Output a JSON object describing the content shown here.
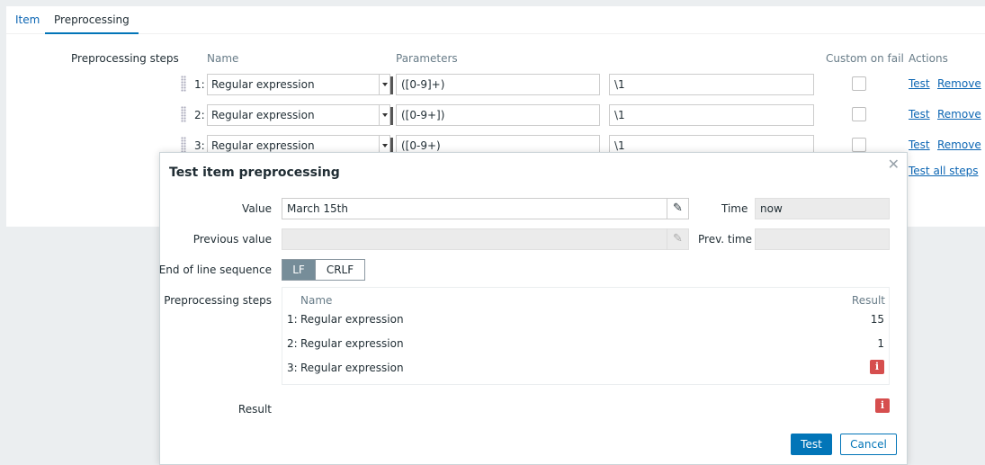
{
  "tabs": [
    {
      "label": "Item"
    },
    {
      "label": "Preprocessing"
    }
  ],
  "form": {
    "section_label": "Preprocessing steps",
    "headers": {
      "name": "Name",
      "parameters": "Parameters",
      "custom_on_fail": "Custom on fail",
      "actions": "Actions"
    },
    "steps": [
      {
        "num": "1:",
        "name": "Regular expression",
        "param1": "([0-9]+)",
        "param2": "\\1",
        "test": "Test",
        "remove": "Remove"
      },
      {
        "num": "2:",
        "name": "Regular expression",
        "param1": "([0-9+])",
        "param2": "\\1",
        "test": "Test",
        "remove": "Remove"
      },
      {
        "num": "3:",
        "name": "Regular expression",
        "param1": "([0-9+)",
        "param2": "\\1",
        "test": "Test",
        "remove": "Remove"
      }
    ],
    "test_all": "Test all steps"
  },
  "dialog": {
    "title": "Test item preprocessing",
    "close_icon": "close-icon",
    "value_label": "Value",
    "value": "March 15th",
    "time_label": "Time",
    "time_value": "now",
    "prev_value_label": "Previous value",
    "prev_value": "",
    "prev_time_label": "Prev. time",
    "prev_time_value": "",
    "eol_label": "End of line sequence",
    "eol_options": [
      "LF",
      "CRLF"
    ],
    "eol_selected": "LF",
    "steps_label": "Preprocessing steps",
    "steps_headers": {
      "name": "Name",
      "result": "Result"
    },
    "steps": [
      {
        "num": "1:",
        "name": "Regular expression",
        "result": "15",
        "error": false
      },
      {
        "num": "2:",
        "name": "Regular expression",
        "result": "1",
        "error": false
      },
      {
        "num": "3:",
        "name": "Regular expression",
        "result": "",
        "error": true
      }
    ],
    "result_label": "Result",
    "result_error": true,
    "error_icon_glyph": "i",
    "test_button": "Test",
    "cancel_button": "Cancel"
  },
  "colors": {
    "primary": "#0275b8",
    "error": "#d64e4e",
    "link": "#0b65b3"
  }
}
